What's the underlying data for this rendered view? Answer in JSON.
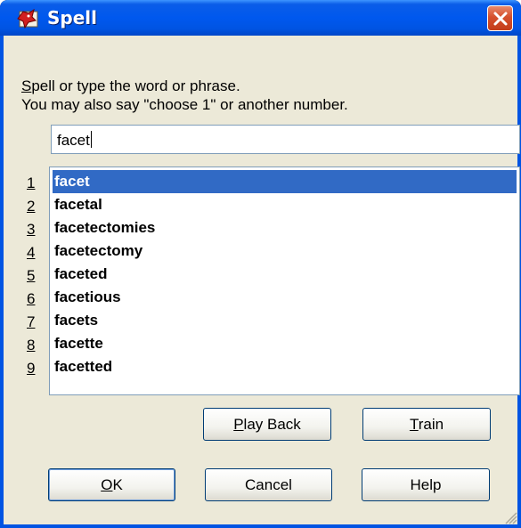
{
  "window": {
    "title": "Spell",
    "app_icon": "dragon-icon",
    "close_icon": "close-icon"
  },
  "instructions": {
    "line1_first": "S",
    "line1_rest": "pell or type the word or phrase.",
    "line2": "You may also say \"choose 1\" or another number."
  },
  "input": {
    "value": "facet"
  },
  "list": {
    "numbers": [
      "1",
      "2",
      "3",
      "4",
      "5",
      "6",
      "7",
      "8",
      "9"
    ],
    "items": [
      "facet",
      "facetal",
      "facetectomies",
      "facetectomy",
      "faceted",
      "facetious",
      "facets",
      "facette",
      "facetted"
    ],
    "selected_index": 0
  },
  "buttons": {
    "play_back": {
      "mnemonic": "P",
      "rest": "lay Back"
    },
    "train": {
      "mnemonic": "T",
      "rest": "rain"
    },
    "ok": {
      "mnemonic": "O",
      "rest": "K"
    },
    "cancel": "Cancel",
    "help": "Help"
  },
  "colors": {
    "titlebar": "#0054e3",
    "selection": "#316ac5",
    "dialog_bg": "#ece9d8",
    "close_button": "#d5502d"
  }
}
